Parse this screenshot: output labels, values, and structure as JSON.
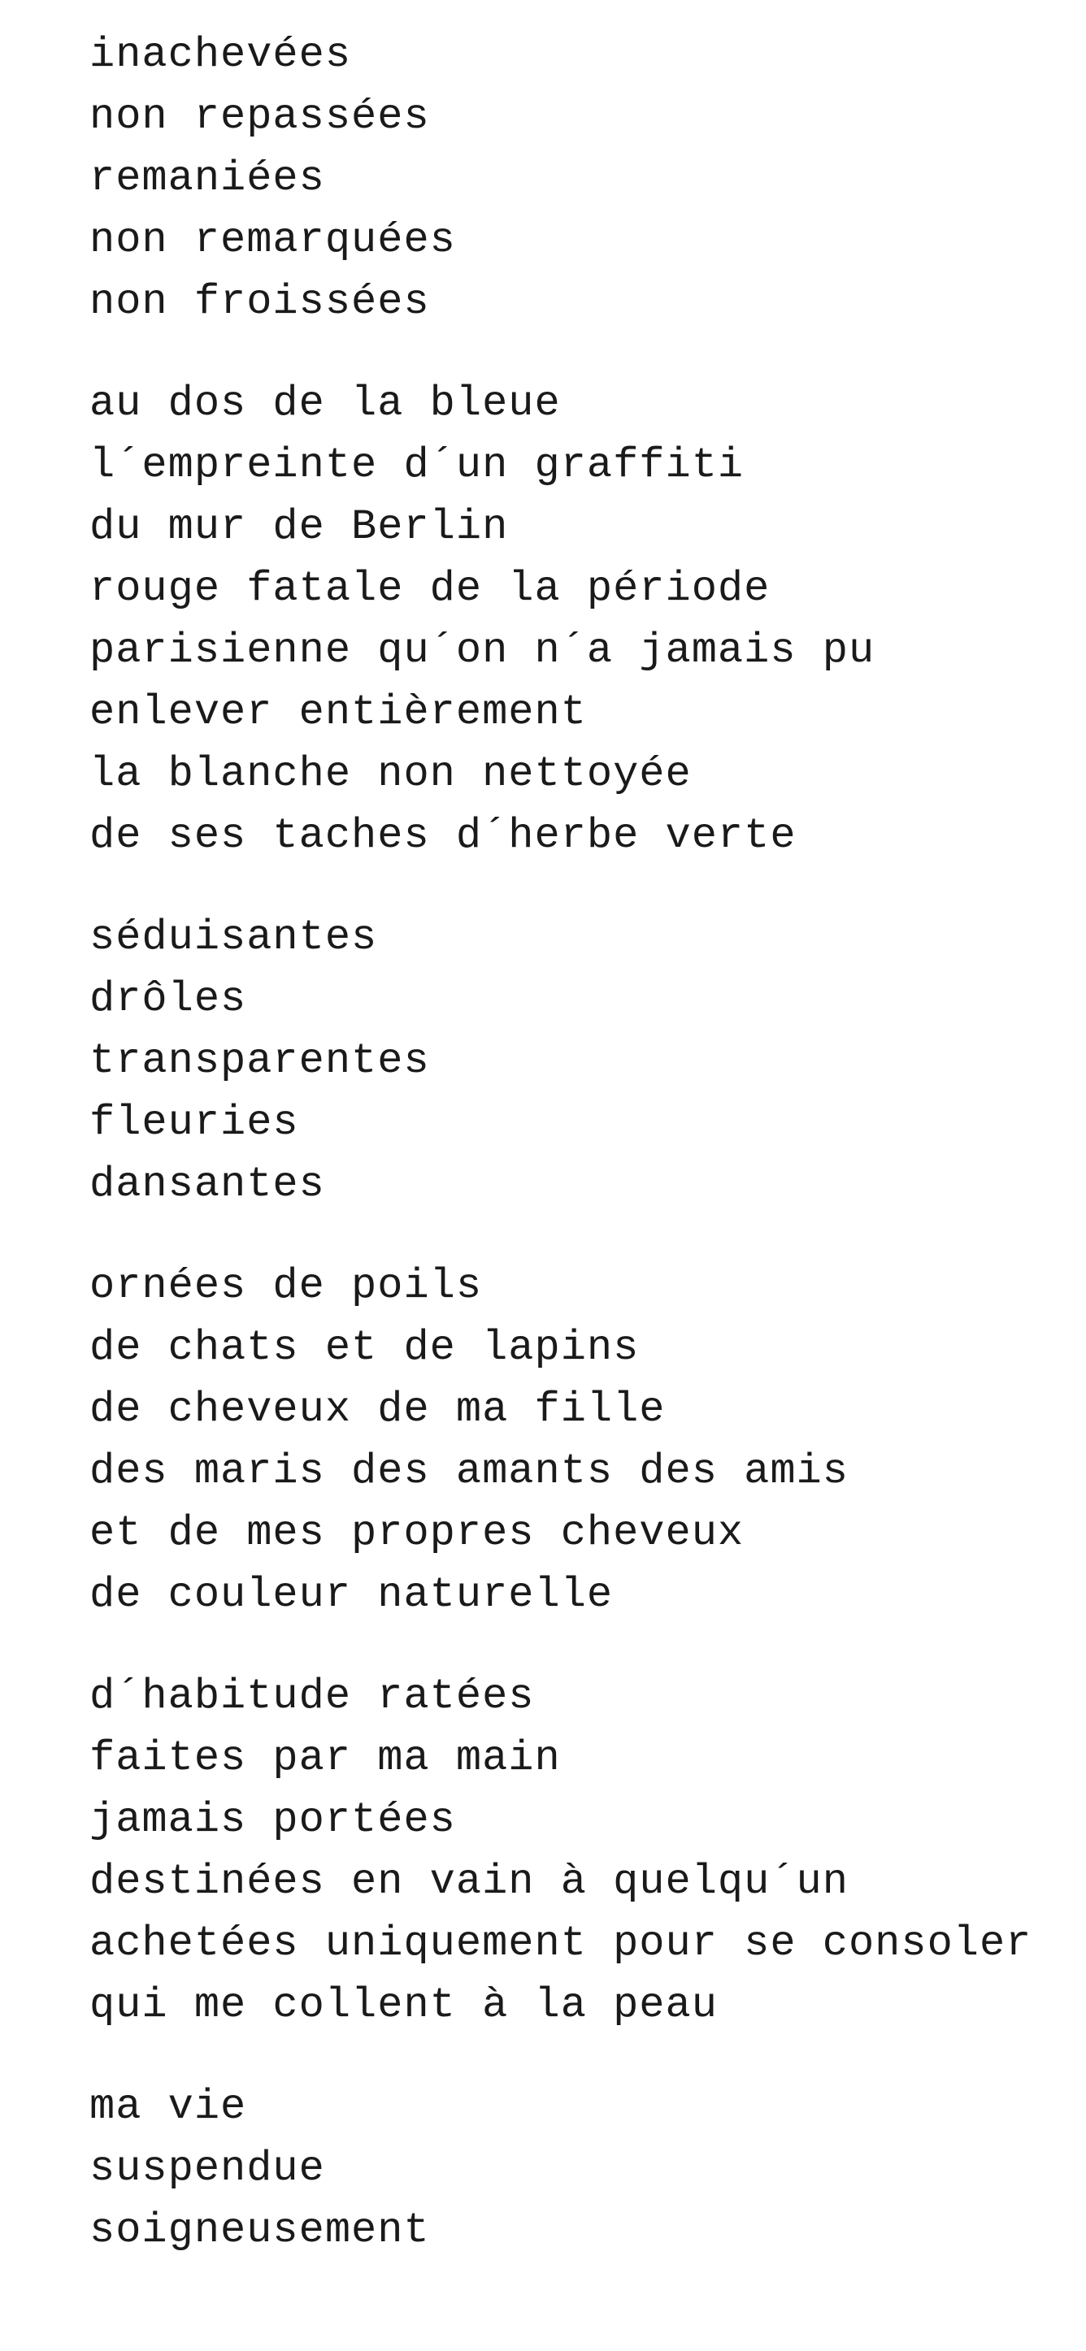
{
  "poem": {
    "stanzas": [
      {
        "lines": [
          "inachevées",
          "non repassées",
          "remaniées",
          "non remarquées",
          "non froissées"
        ]
      },
      {
        "lines": [
          "au dos de la bleue",
          "l´empreinte d´un graffiti",
          "du mur de Berlin",
          "rouge fatale de la période",
          "parisienne qu´on n´a jamais pu",
          "enlever entièrement",
          "la blanche non nettoyée",
          "de ses taches d´herbe verte"
        ]
      },
      {
        "lines": [
          "séduisantes",
          "drôles",
          "transparentes",
          "fleuries",
          "dansantes"
        ]
      },
      {
        "lines": [
          "ornées de poils",
          "de chats et de lapins",
          "de cheveux de ma fille",
          "des maris des amants des amis",
          "et de mes propres cheveux",
          "de couleur naturelle"
        ]
      },
      {
        "lines": [
          "d´habitude ratées",
          "faites par ma main",
          "jamais portées",
          "destinées en vain à quelqu´un",
          "achetées uniquement pour se consoler",
          "qui me collent à la peau"
        ]
      },
      {
        "lines": [
          "ma vie",
          "suspendue",
          "soigneusement"
        ]
      }
    ]
  }
}
